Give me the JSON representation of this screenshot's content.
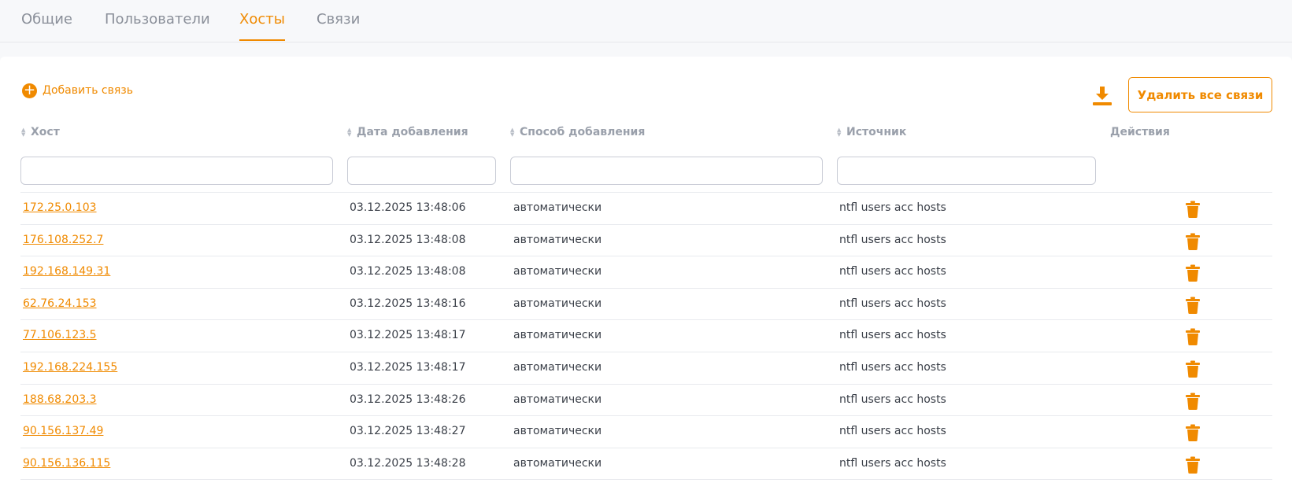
{
  "tabs": [
    {
      "label": "Общие",
      "active": false
    },
    {
      "label": "Пользователи",
      "active": false
    },
    {
      "label": "Хосты",
      "active": true
    },
    {
      "label": "Связи",
      "active": false
    }
  ],
  "toolbar": {
    "add_label": "Добавить связь",
    "add_icon": "plus-circle-icon",
    "download_icon": "download-icon",
    "delete_all_label": "Удалить все связи"
  },
  "table": {
    "columns": [
      "Хост",
      "Дата добавления",
      "Способ добавления",
      "Источник",
      "Действия"
    ],
    "filters": {
      "host": "",
      "date": "",
      "method": "",
      "source": ""
    },
    "rows": [
      {
        "host": "172.25.0.103",
        "date": "03.12.2025 13:48:06",
        "method": "автоматически",
        "source": "ntfl users acc hosts"
      },
      {
        "host": "176.108.252.7",
        "date": "03.12.2025 13:48:08",
        "method": "автоматически",
        "source": "ntfl users acc hosts"
      },
      {
        "host": "192.168.149.31",
        "date": "03.12.2025 13:48:08",
        "method": "автоматически",
        "source": "ntfl users acc hosts"
      },
      {
        "host": "62.76.24.153",
        "date": "03.12.2025 13:48:16",
        "method": "автоматически",
        "source": "ntfl users acc hosts"
      },
      {
        "host": "77.106.123.5",
        "date": "03.12.2025 13:48:17",
        "method": "автоматически",
        "source": "ntfl users acc hosts"
      },
      {
        "host": "192.168.224.155",
        "date": "03.12.2025 13:48:17",
        "method": "автоматически",
        "source": "ntfl users acc hosts"
      },
      {
        "host": "188.68.203.3",
        "date": "03.12.2025 13:48:26",
        "method": "автоматически",
        "source": "ntfl users acc hosts"
      },
      {
        "host": "90.156.137.49",
        "date": "03.12.2025 13:48:27",
        "method": "автоматически",
        "source": "ntfl users acc hosts"
      },
      {
        "host": "90.156.136.115",
        "date": "03.12.2025 13:48:28",
        "method": "автоматически",
        "source": "ntfl users acc hosts"
      }
    ],
    "row_action_icon": "trash-icon"
  },
  "colors": {
    "accent": "#f08a00",
    "header_text": "#9aa0ab",
    "body_text": "#3a3f48"
  }
}
